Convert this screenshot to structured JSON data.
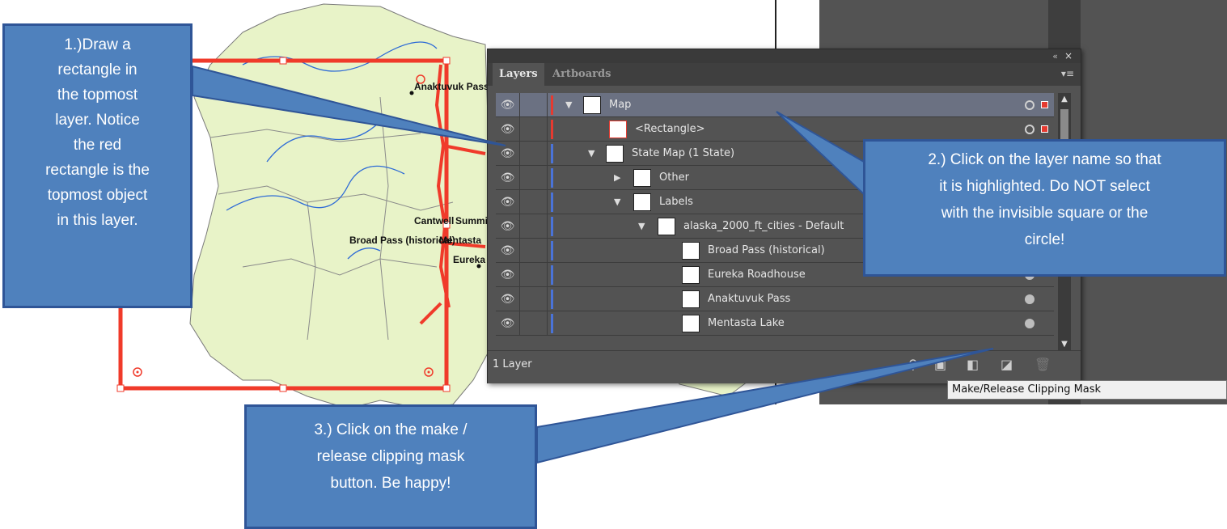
{
  "map": {
    "labels": {
      "anaktuvuk": "Anaktuvuk Pass",
      "cantwell": "Cantwell",
      "summit": "Summit",
      "broad_pass": "Broad Pass (historical)",
      "mentasta": "Mentasta",
      "eureka": "Eureka"
    }
  },
  "panel": {
    "tabs": [
      "Layers",
      "Artboards"
    ],
    "collapse_glyph": "«",
    "close_glyph": "×",
    "menu_glyph": "▾≡",
    "rows": [
      {
        "label": "Map",
        "color": "#e53a30",
        "selected": true
      },
      {
        "label": "<Rectangle>",
        "color": "#e53a30"
      },
      {
        "label": "State Map (1 State)",
        "color": "#4a73d8"
      },
      {
        "label": "Other",
        "color": "#4a73d8"
      },
      {
        "label": "Labels",
        "color": "#4a73d8"
      },
      {
        "label": "alaska_2000_ft_cities - Default",
        "color": "#4a73d8"
      },
      {
        "label": "Broad Pass (historical)",
        "color": "#4a73d8"
      },
      {
        "label": "Eureka Roadhouse",
        "color": "#4a73d8"
      },
      {
        "label": "Anaktuvuk Pass",
        "color": "#4a73d8"
      },
      {
        "label": "Mentasta Lake",
        "color": "#4a73d8"
      }
    ],
    "footer": {
      "layer_count": "1 Layer"
    },
    "tooltip": "Make/Release Clipping Mask"
  },
  "callouts": {
    "c1": "1.)Draw a\nrectangle in\nthe topmost\nlayer. Notice\nthe red\nrectangle is the\ntopmost object\nin this layer.",
    "c2": "2.) Click on the layer name so that\nit is highlighted.  Do NOT select\nwith the invisible square or the\ncircle!",
    "c3": "3.) Click on the make /\nrelease clipping mask\nbutton.  Be happy!"
  },
  "colors": {
    "callout_fill": "#4f81bd",
    "callout_border": "#2f5597",
    "panel_bg": "#535353",
    "selected_row": "#6b7182",
    "map_land": "#e8f3c8",
    "clip_rect": "#f03a2a"
  },
  "icons": {
    "eye": "eye-icon",
    "search": "search-icon",
    "make_clipping_mask": "clipping-mask-icon",
    "sublayer": "new-sublayer-icon",
    "new_layer": "new-layer-icon",
    "delete": "trash-icon"
  }
}
